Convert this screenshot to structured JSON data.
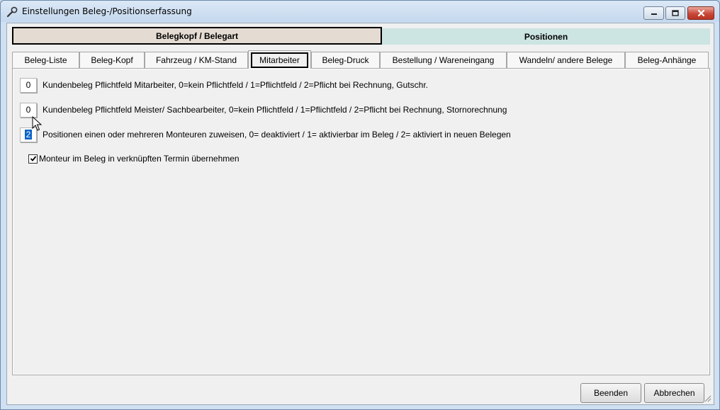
{
  "window": {
    "title": "Einstellungen Beleg-/Positionserfassung",
    "title_icon": "wrench-icon",
    "controls": [
      "minimize-icon",
      "maximize-icon",
      "close-icon"
    ]
  },
  "header_tabs": {
    "left": "Belegkopf / Belegart",
    "right": "Positionen"
  },
  "tabs": [
    {
      "label": "Beleg-Liste"
    },
    {
      "label": "Beleg-Kopf"
    },
    {
      "label": "Fahrzeug / KM-Stand"
    },
    {
      "label": "Mitarbeiter",
      "active": true
    },
    {
      "label": "Beleg-Druck"
    },
    {
      "label": "Bestellung / Wareneingang"
    },
    {
      "label": "Wandeln/ andere Belege"
    },
    {
      "label": "Beleg-Anhänge"
    }
  ],
  "settings": [
    {
      "value": "0",
      "label": "Kundenbeleg Pflichtfeld Mitarbeiter, 0=kein Pflichtfeld / 1=Pflichtfeld / 2=Pflicht bei Rechnung, Gutschr."
    },
    {
      "value": "0",
      "label": "Kundenbeleg Pflichtfeld Meister/ Sachbearbeiter, 0=kein Pflichtfeld / 1=Pflichtfeld / 2=Pflicht bei Rechnung, Stornorechnung"
    },
    {
      "value": "2",
      "label": "Positionen einen oder mehreren Monteuren zuweisen, 0= deaktiviert / 1= aktivierbar im Beleg / 2= aktiviert in neuen Belegen",
      "selected": true
    }
  ],
  "checkbox": {
    "checked": true,
    "label": "Monteur im Beleg in verknüpften Termin übernehmen"
  },
  "buttons": {
    "beenden": "Beenden",
    "abbrechen": "Abbrechen"
  },
  "colors": {
    "selection": "#0a64c8",
    "header_left_bg": "#e4dcd2",
    "header_right_bg": "#cce4e2",
    "close_button": "#c9483a"
  }
}
